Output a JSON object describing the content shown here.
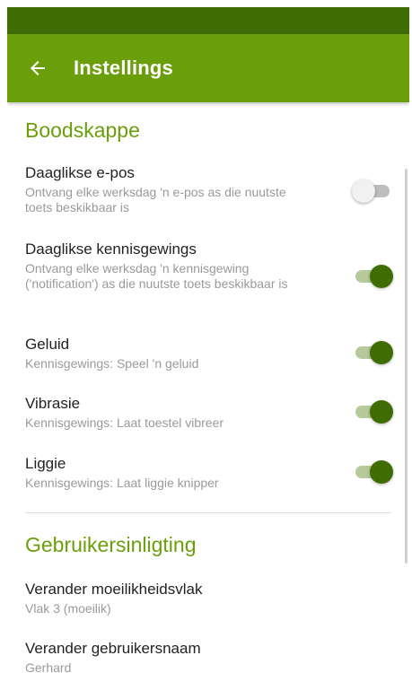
{
  "appbar": {
    "title": "Instellings",
    "back_icon": "arrow-back-icon"
  },
  "sections": [
    {
      "title": "Boodskappe"
    },
    {
      "title": "Gebruikersinligting"
    }
  ],
  "prefs": [
    {
      "title": "Daaglikse e-pos",
      "summary": "Ontvang elke werksdag 'n e-pos as die nuutste toets beskikbaar is",
      "on": false
    },
    {
      "title": "Daaglikse kennisgewings",
      "summary": "Ontvang elke werksdag 'n kennisgewing ('notification') as die nuutste toets beskikbaar is",
      "on": true
    },
    {
      "title": "Geluid",
      "summary": "Kennisgewings: Speel 'n geluid",
      "on": true
    },
    {
      "title": "Vibrasie",
      "summary": "Kennisgewings: Laat toestel vibreer",
      "on": true
    },
    {
      "title": "Liggie",
      "summary": "Kennisgewings: Laat liggie knipper",
      "on": true
    },
    {
      "title": "Verander moeilikheidsvlak",
      "summary": "Vlak 3 (moeilik)"
    },
    {
      "title": "Verander gebruikersnaam",
      "summary": "Gerhard"
    }
  ],
  "colors": {
    "statusbar": "#3f6d04",
    "appbar": "#6a9f0b",
    "accent": "#6a9f0b",
    "switch_on": "#3f6d04"
  }
}
